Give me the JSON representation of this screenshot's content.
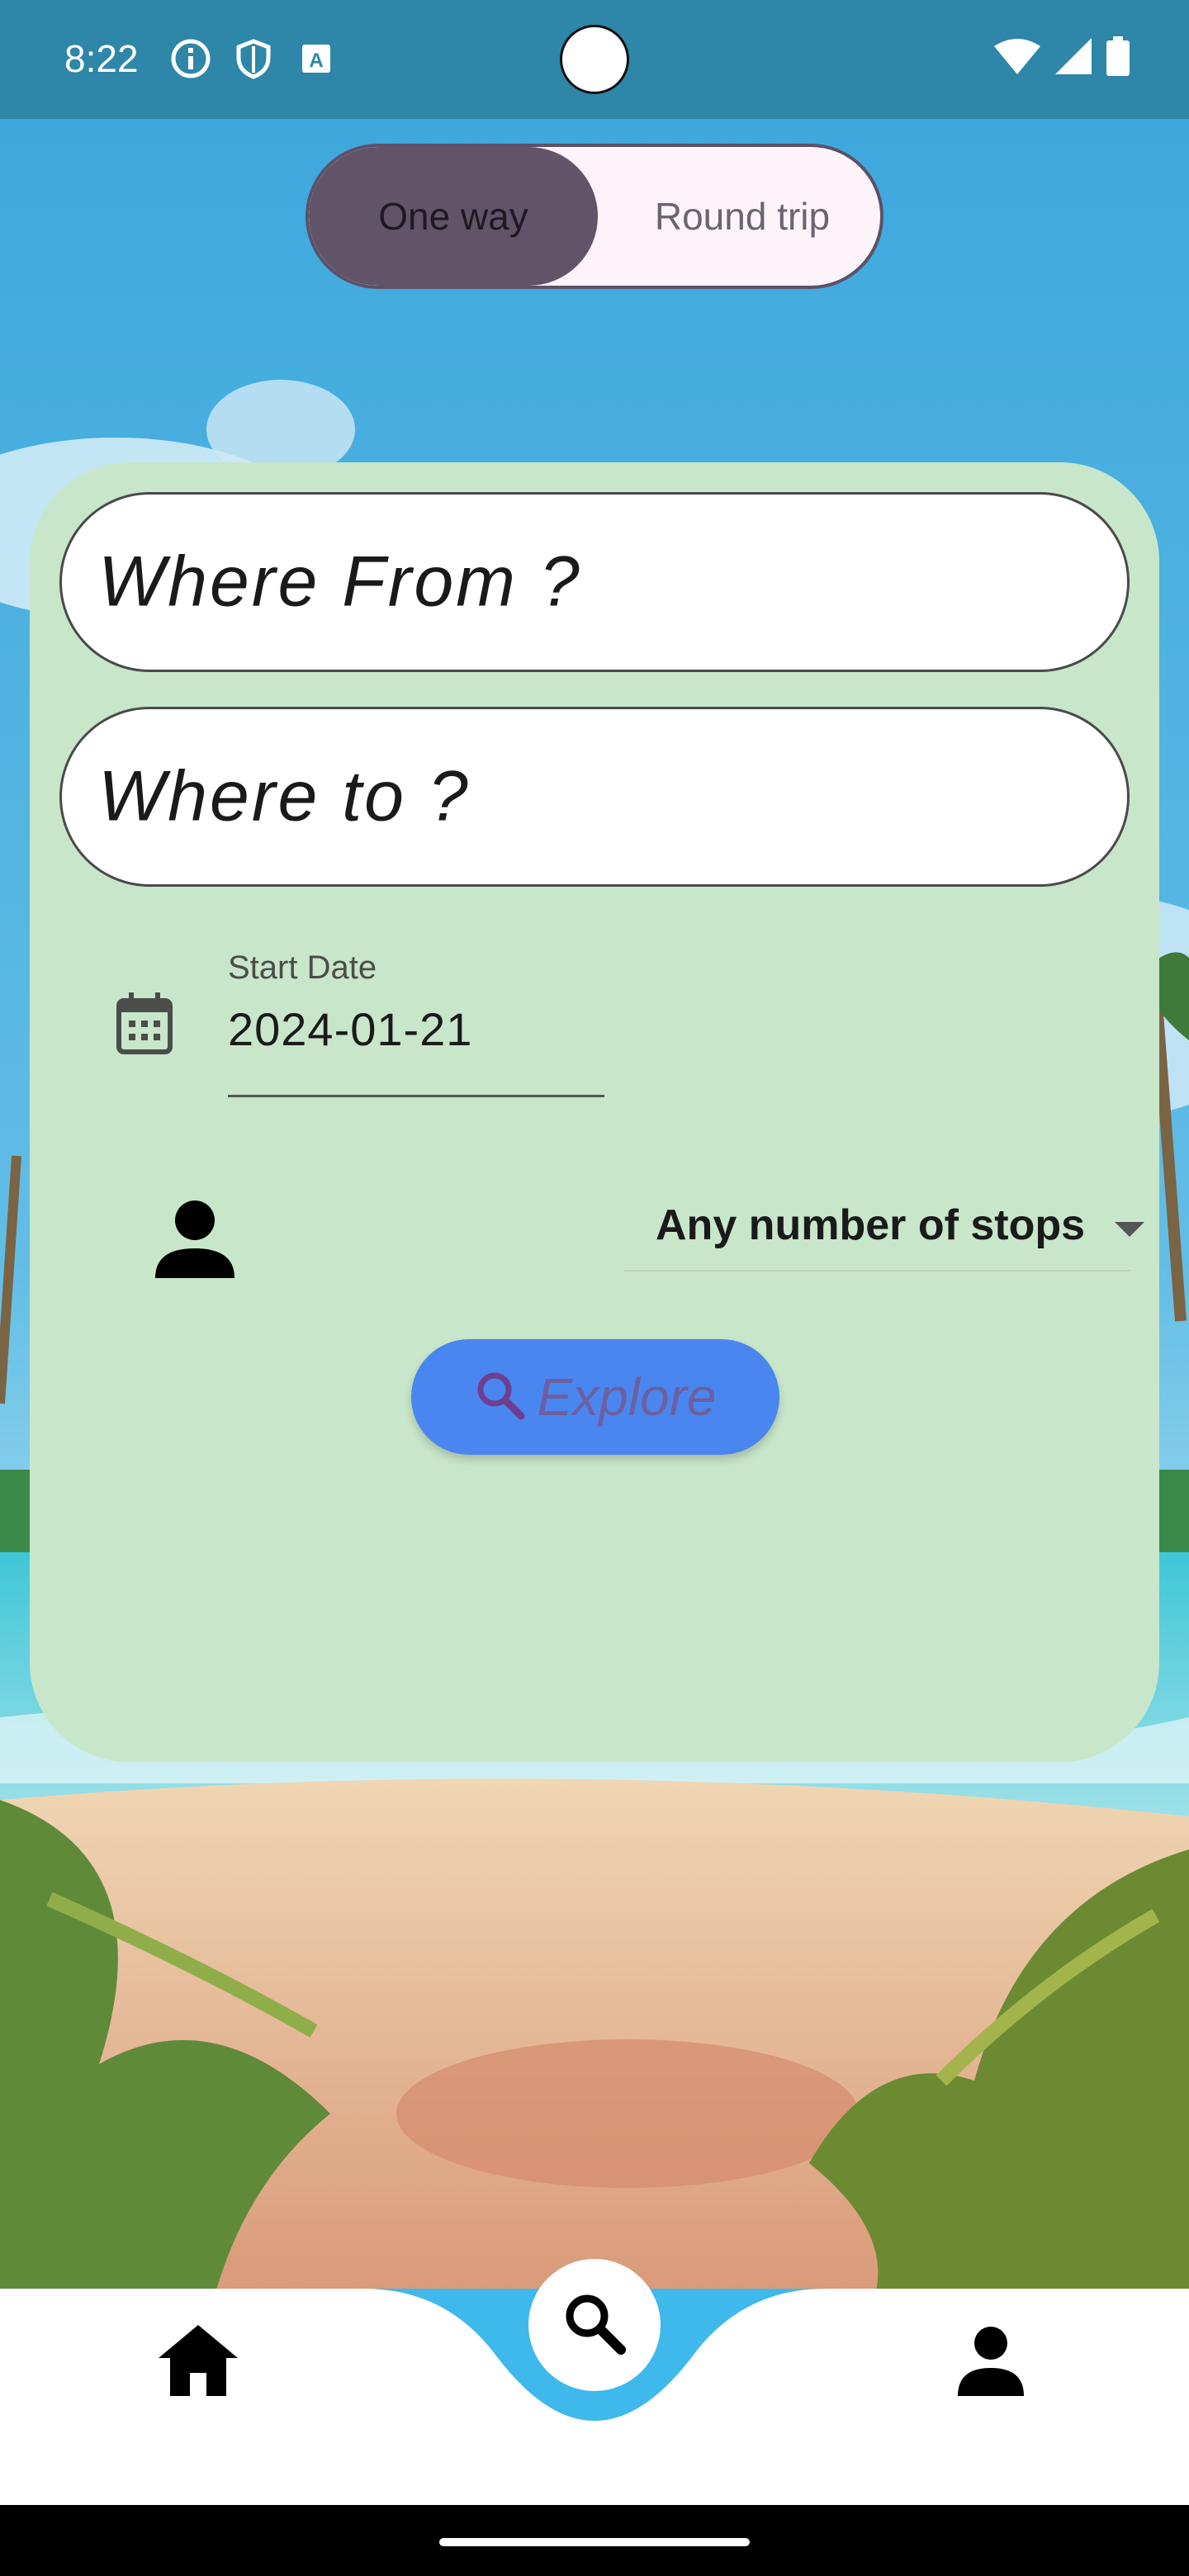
{
  "status_bar": {
    "time": "8:22",
    "left_icons": [
      "info-icon",
      "shield-icon",
      "font-icon"
    ],
    "right_icons": [
      "wifi-icon",
      "signal-icon",
      "battery-icon"
    ]
  },
  "trip_toggle": {
    "selected": "One way",
    "options": [
      "One way",
      "Round trip"
    ]
  },
  "search": {
    "from_placeholder": "Where From ?",
    "to_placeholder": "Where to ?",
    "start_date_label": "Start Date",
    "start_date_value": "2024-01-21",
    "stops_selected": "Any number of stops",
    "explore_label": "Explore"
  },
  "icons": {
    "calendar": "calendar-icon",
    "passenger": "person-icon",
    "dropdown": "chevron-down-icon",
    "explore": "search-icon"
  },
  "bottom_nav": {
    "items": [
      "home-icon",
      "search-icon",
      "person-icon"
    ],
    "active": "search-icon"
  },
  "colors": {
    "card": "#c8e6c9",
    "explore_button": "#4a86f0",
    "toggle_selected": "#615468",
    "nav_accent": "#3fb8ec",
    "status_bar": "#2e86a8"
  }
}
